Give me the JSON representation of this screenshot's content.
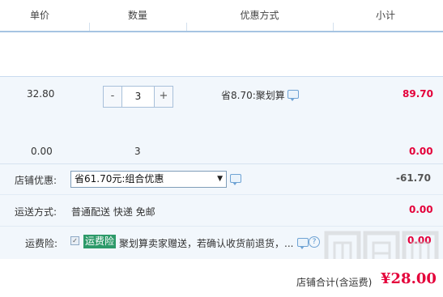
{
  "header": {
    "col_price": "单价",
    "col_qty": "数量",
    "col_discount": "优惠方式",
    "col_subtotal": "小计"
  },
  "item": {
    "price": "32.80",
    "quantity": "3",
    "minus_label": "-",
    "plus_label": "+",
    "discount": "省8.70:聚划算",
    "subtotal": "89.70"
  },
  "item_extra": {
    "price": "0.00",
    "quantity": "3",
    "subtotal": "0.00"
  },
  "shop_discount": {
    "label": "店铺优惠:",
    "selected": "省61.70元:组合优惠",
    "amount": "-61.70"
  },
  "shipping": {
    "label": "运送方式:",
    "method": "普通配送 快递 免邮",
    "amount": "0.00"
  },
  "insurance": {
    "label": "运费险:",
    "checkbox_mark": "✓",
    "badge": "运费险",
    "description": "聚划算卖家赠送，若确认收货前退货，...",
    "amount": "0.00",
    "help_mark": "?"
  },
  "footer": {
    "total_label": "店铺合计(含运费)",
    "total_value": "¥28.00"
  },
  "colors": {
    "accent_red": "#e4003a",
    "border_blue": "#a6c4e2",
    "row_bg": "#f2f7fc",
    "badge_green": "#2d9a69"
  }
}
